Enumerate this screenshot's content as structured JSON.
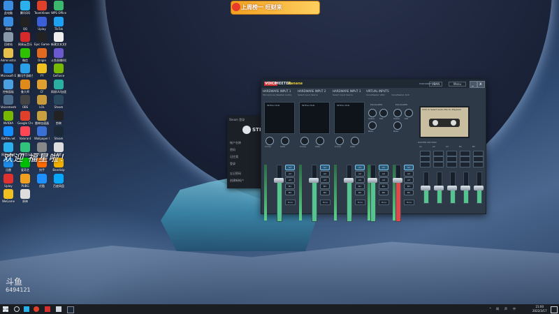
{
  "desktop": {
    "icons": [
      {
        "label": "此电脑",
        "color": "#3a8de0"
      },
      {
        "label": "腾讯QQ",
        "color": "#2bb0ee"
      },
      {
        "label": "TeamViewer",
        "color": "#e0402a"
      },
      {
        "label": "WPS Office",
        "color": "#3bb86b"
      },
      {
        "label": "网络",
        "color": "#3a8de0"
      },
      {
        "label": "QQ",
        "color": "#222222"
      },
      {
        "label": "Uplay",
        "color": "#3a5fd6"
      },
      {
        "label": "TikTok",
        "color": "#1da1f2"
      },
      {
        "label": "回收站",
        "color": "#8899aa"
      },
      {
        "label": "网易云音乐",
        "color": "#d42a2a"
      },
      {
        "label": "Epic Games",
        "color": "#222222"
      },
      {
        "label": "新建文本文档",
        "color": "#eeeeee"
      },
      {
        "label": "Administrator",
        "color": "#e6c04a"
      },
      {
        "label": "微信",
        "color": "#2dc100"
      },
      {
        "label": "Origin",
        "color": "#e06a1f"
      },
      {
        "label": "斗鱼直播伴侣",
        "color": "#6a5acd"
      },
      {
        "label": "Microsoft Edge",
        "color": "#1d7fd8"
      },
      {
        "label": "腾讯手游助手",
        "color": "#2aa0e8"
      },
      {
        "label": "YY",
        "color": "#f0c020"
      },
      {
        "label": "GeForce",
        "color": "#76b900"
      },
      {
        "label": "控制面板",
        "color": "#4aa0e0"
      },
      {
        "label": "鲁大师",
        "color": "#e08a1a"
      },
      {
        "label": "CF",
        "color": "#e0a030"
      },
      {
        "label": "网易UU加速器",
        "color": "#2ab0a0"
      },
      {
        "label": "Voicemeeter",
        "color": "#4a6a8a"
      },
      {
        "label": "OBS",
        "color": "#444444"
      },
      {
        "label": "LOL",
        "color": "#c89b3c"
      },
      {
        "label": "Steam",
        "color": "#2a475e"
      },
      {
        "label": "NVIDIA",
        "color": "#76b900"
      },
      {
        "label": "Google Chrome",
        "color": "#e0402a"
      },
      {
        "label": "雷神加速器",
        "color": "#c8a040"
      },
      {
        "label": "剪映",
        "color": "#222222"
      },
      {
        "label": "Battle.net",
        "color": "#148eff"
      },
      {
        "label": "Valorant",
        "color": "#ff4655"
      },
      {
        "label": "Wallpaper Engine",
        "color": "#3a6fd6"
      },
      {
        "label": "Steam",
        "color": "#1b2838"
      },
      {
        "label": "网易云游戏",
        "color": "#2bb0ee"
      },
      {
        "label": "QQ音乐",
        "color": "#31c27c"
      },
      {
        "label": "GTA5",
        "color": "#888888"
      },
      {
        "label": "设置",
        "color": "#dddddd"
      },
      {
        "label": "迅雷",
        "color": "#1d8ae8"
      },
      {
        "label": "爱奇艺",
        "color": "#00be06"
      },
      {
        "label": "快手",
        "color": "#ff6a00"
      },
      {
        "label": "Bandizip",
        "color": "#f0b000"
      },
      {
        "label": "Uplay",
        "color": "#e03030"
      },
      {
        "label": "PUBG",
        "color": "#f0a020"
      },
      {
        "label": "优酷",
        "color": "#1e90ff"
      },
      {
        "label": "百度网盘",
        "color": "#06a7ff"
      },
      {
        "label": "WeGame",
        "color": "#f0c020"
      },
      {
        "label": "原神",
        "color": "#dddddd"
      }
    ]
  },
  "banner": {
    "text": "上周榜一 旺财来"
  },
  "stream_overlay": {
    "text": "欢迎 福星啦！",
    "room_label": "斗鱼",
    "room_number": "6494121"
  },
  "steam_window": {
    "title": "Steam 登录",
    "logo_text": "STEA",
    "rows": [
      "帐户名称",
      "密码",
      "记住我",
      "登录",
      "忘记密码",
      "创建新帐户"
    ]
  },
  "voicemeeter": {
    "brand_voice": "VOICE",
    "brand_meeter": "MEETER",
    "brand_banana": "Banana",
    "vst_label": "VBAN",
    "menu_label": "Menu",
    "window_buttons": [
      "_",
      "x"
    ],
    "strips": [
      {
        "header": "HARDWARE INPUT 1",
        "sub": "Microphone (Realtek Audio)",
        "pad_label": "INTELLI PAN",
        "knobs": [
          "Comp",
          "Gate"
        ],
        "mute": "Mute",
        "fill": 0.72,
        "red": false
      },
      {
        "header": "HARDWARE INPUT 2",
        "sub": "Select input device",
        "pad_label": "INTELLI PAN",
        "knobs": [
          "Comp",
          "Gate"
        ],
        "mute": "Mute",
        "fill": 0.72,
        "red": false
      },
      {
        "header": "HARDWARE INPUT 3",
        "sub": "Select input device",
        "pad_label": "INTELLI PAN",
        "knobs": [
          "Comp",
          "Gate"
        ],
        "mute": "Mute",
        "fill": 0.72,
        "red": false
      },
      {
        "header": "VIRTUAL INPUTS",
        "sub": "VoiceMeeter VAIO",
        "pad_label": "EQUALIZER",
        "knobs": [
          "Treble",
          "Mid",
          "Bass"
        ],
        "mute": "Mute",
        "fill": 0.72,
        "red": false
      },
      {
        "header": "",
        "sub": "VoiceMeeter AUX",
        "pad_label": "EQUALIZER",
        "knobs": [
          "Treble",
          "Mid",
          "Bass"
        ],
        "mute": "Mute",
        "fill": 0.72,
        "red": true
      }
    ],
    "bus_buttons": [
      "A1",
      "A2",
      "A3",
      "B1",
      "B2"
    ],
    "hw_out_header": "HARDWARE OUT",
    "cassette": {
      "title": "Click to Select Audio File for Playback",
      "button_rec": "REC"
    },
    "master_header": "MASTER SECTION",
    "master_buses": [
      "A1",
      "A2",
      "A3",
      "B1",
      "B2"
    ],
    "master_fill": [
      0.48,
      0.48,
      0.48,
      0.48,
      0.48
    ]
  },
  "taskbar": {
    "time": "21:00",
    "date": "2022/3/17",
    "tray_icons": [
      "^",
      "网",
      "声",
      "中"
    ]
  }
}
